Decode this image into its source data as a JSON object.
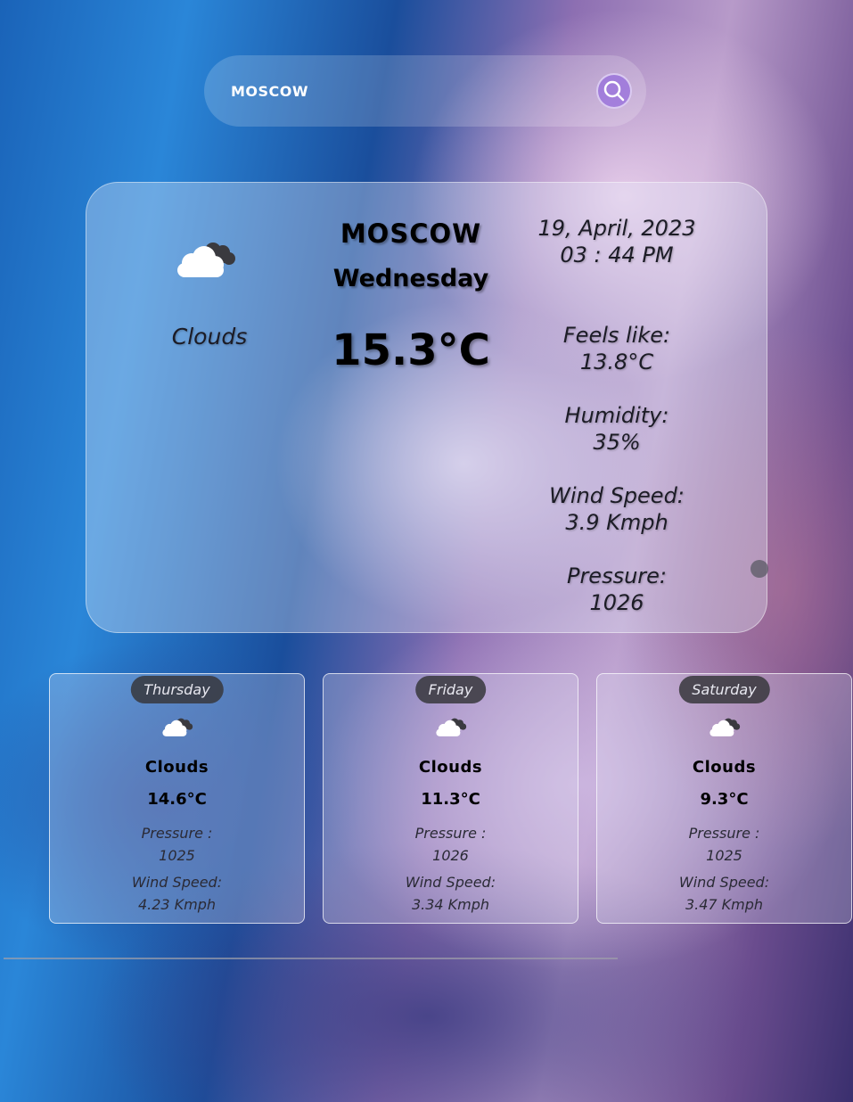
{
  "search": {
    "value": "MOSCOW",
    "button_icon": "search-icon"
  },
  "current": {
    "icon": "clouds-icon",
    "condition": "Clouds",
    "city": "MOSCOW",
    "day": "Wednesday",
    "temperature": "15.3°C",
    "date": "19, April, 2023",
    "time": "03 : 44 PM",
    "feels_like_label": "Feels like:",
    "feels_like_value": "13.8°C",
    "humidity_label": "Humidity:",
    "humidity_value": "35%",
    "wind_label": "Wind Speed:",
    "wind_value": "3.9 Kmph",
    "pressure_label": "Pressure:",
    "pressure_value": "1026"
  },
  "forecast": [
    {
      "day": "Thursday",
      "icon": "clouds-icon",
      "condition": "Clouds",
      "temperature": "14.6°C",
      "pressure_label": "Pressure :",
      "pressure_value": "1025",
      "wind_label": "Wind Speed:",
      "wind_value": "4.23 Kmph"
    },
    {
      "day": "Friday",
      "icon": "clouds-icon",
      "condition": "Clouds",
      "temperature": "11.3°C",
      "pressure_label": "Pressure :",
      "pressure_value": "1026",
      "wind_label": "Wind Speed:",
      "wind_value": "3.34 Kmph"
    },
    {
      "day": "Saturday",
      "icon": "clouds-icon",
      "condition": "Clouds",
      "temperature": "9.3°C",
      "pressure_label": "Pressure :",
      "pressure_value": "1025",
      "wind_label": "Wind Speed:",
      "wind_value": "3.47 Kmph"
    }
  ],
  "colors": {
    "search_button": "#9a6fe0",
    "day_badge": "#37373c",
    "text_dark": "#1c1c26"
  }
}
